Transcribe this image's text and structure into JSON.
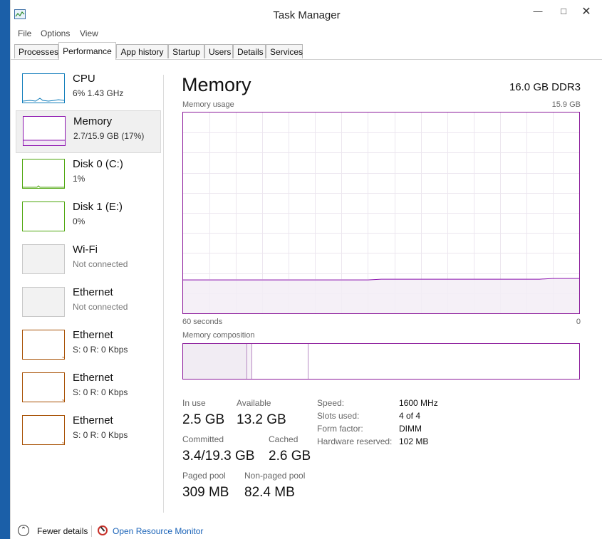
{
  "window": {
    "title": "Task Manager"
  },
  "menu": [
    "File",
    "Options",
    "View"
  ],
  "tabs": [
    "Processes",
    "Performance",
    "App history",
    "Startup",
    "Users",
    "Details",
    "Services"
  ],
  "active_tab": "Performance",
  "sidebar": [
    {
      "name": "CPU",
      "sub": "6% 1.43 GHz",
      "color": "#117dbb"
    },
    {
      "name": "Memory",
      "sub": "2.7/15.9 GB (17%)",
      "color": "#8b12ae"
    },
    {
      "name": "Disk 0 (C:)",
      "sub": "1%",
      "color": "#4da60c"
    },
    {
      "name": "Disk 1 (E:)",
      "sub": "0%",
      "color": "#4da60c"
    },
    {
      "name": "Wi-Fi",
      "sub": "Not connected",
      "color": "#c8c8c8"
    },
    {
      "name": "Ethernet",
      "sub": "Not connected",
      "color": "#c8c8c8"
    },
    {
      "name": "Ethernet",
      "sub": "S: 0 R: 0 Kbps",
      "color": "#a74f01"
    },
    {
      "name": "Ethernet",
      "sub": "S: 0 R: 0 Kbps",
      "color": "#a74f01"
    },
    {
      "name": "Ethernet",
      "sub": "S: 0 R: 0 Kbps",
      "color": "#a74f01"
    }
  ],
  "main": {
    "title": "Memory",
    "spec": "16.0 GB DDR3",
    "usage_label": "Memory usage",
    "usage_max": "15.9 GB",
    "time_left": "60 seconds",
    "time_right": "0",
    "composition_label": "Memory composition",
    "usage_fraction": 0.17,
    "composition_fractions": {
      "in_use": 0.16,
      "modified": 0.01,
      "standby": 0.15
    },
    "stats": {
      "in_use_label": "In use",
      "in_use": "2.5 GB",
      "available_label": "Available",
      "available": "13.2 GB",
      "committed_label": "Committed",
      "committed": "3.4/19.3 GB",
      "cached_label": "Cached",
      "cached": "2.6 GB",
      "paged_label": "Paged pool",
      "paged": "309 MB",
      "nonpaged_label": "Non-paged pool",
      "nonpaged": "82.4 MB"
    },
    "details": [
      {
        "key": "Speed:",
        "value": "1600 MHz"
      },
      {
        "key": "Slots used:",
        "value": "4 of 4"
      },
      {
        "key": "Form factor:",
        "value": "DIMM"
      },
      {
        "key": "Hardware reserved:",
        "value": "102 MB"
      }
    ]
  },
  "footer": {
    "fewer_details": "Fewer details",
    "resource_monitor": "Open Resource Monitor"
  },
  "accent": "#8b12ae"
}
